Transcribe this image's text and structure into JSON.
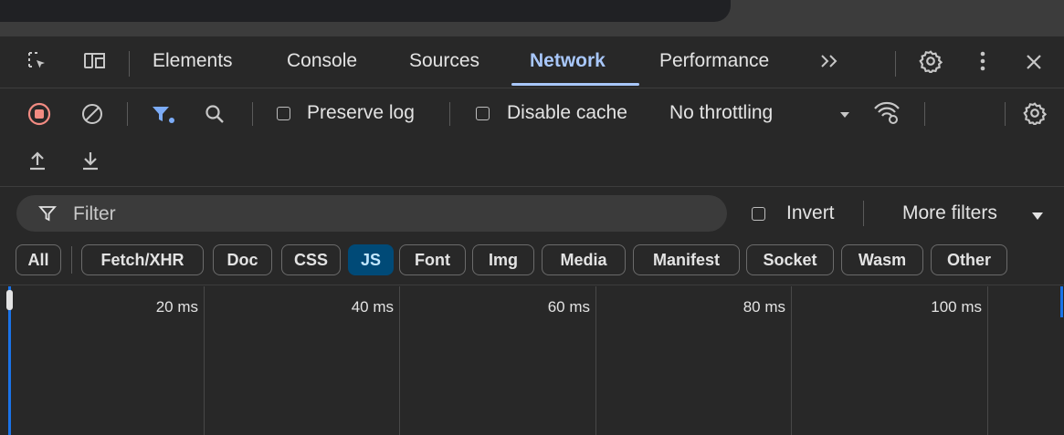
{
  "tabs": [
    {
      "label": "Elements"
    },
    {
      "label": "Console"
    },
    {
      "label": "Sources"
    },
    {
      "label": "Network"
    },
    {
      "label": "Performance"
    }
  ],
  "toolbar": {
    "preserve_log": "Preserve log",
    "disable_cache": "Disable cache",
    "throttling": "No throttling"
  },
  "filter": {
    "placeholder": "Filter",
    "invert_label": "Invert",
    "more_filters": "More filters"
  },
  "type_filters": [
    {
      "label": "All"
    },
    {
      "label": "Fetch/XHR"
    },
    {
      "label": "Doc"
    },
    {
      "label": "CSS"
    },
    {
      "label": "JS"
    },
    {
      "label": "Font"
    },
    {
      "label": "Img"
    },
    {
      "label": "Media"
    },
    {
      "label": "Manifest"
    },
    {
      "label": "Socket"
    },
    {
      "label": "Wasm"
    },
    {
      "label": "Other"
    }
  ],
  "active_tab": "Network",
  "active_type_filter": "JS",
  "timeline": {
    "ticks": [
      "20 ms",
      "40 ms",
      "60 ms",
      "80 ms",
      "100 ms"
    ]
  },
  "colors": {
    "accent": "#a8c7fa",
    "record_red": "#f28b82",
    "filter_blue": "#7cacf8",
    "chip_active": "#004a77"
  }
}
